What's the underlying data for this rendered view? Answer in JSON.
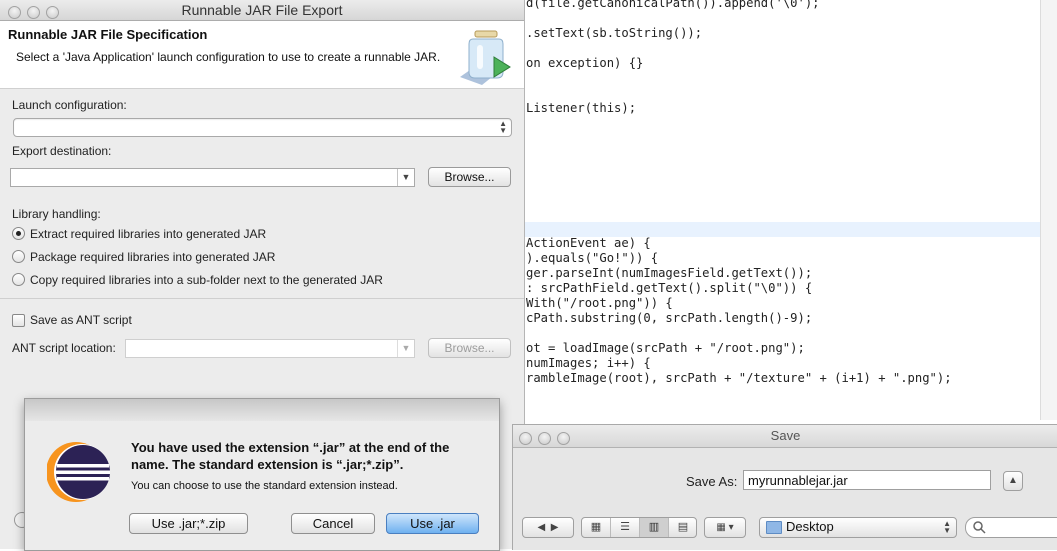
{
  "editor": {
    "lines": [
      "d(file.getCanonicalPath()).append('\\0');",
      ".setText(sb.toString());",
      "on exception) {}",
      "Listener(this);",
      "ActionEvent ae) {",
      ").equals(\"Go!\")) {",
      "ger.parseInt(numImagesField.getText());",
      ": srcPathField.getText().split(\"\\0\")) {",
      "With(\"/root.png\")) {",
      "cPath.substring(0, srcPath.length()-9);",
      "ot = loadImage(srcPath + \"/root.png\");",
      "numImages; i++) {",
      "rambleImage(root), srcPath + \"/texture\" + (i+1) + \".png\");"
    ]
  },
  "export_dialog": {
    "window_title": "Runnable JAR File Export",
    "heading": "Runnable JAR File Specification",
    "description": "Select a 'Java Application' launch configuration to use to create a runnable JAR.",
    "launch_label": "Launch configuration:",
    "launch_value": "",
    "destination_label": "Export destination:",
    "destination_value": "",
    "browse_label": "Browse...",
    "library_label": "Library handling:",
    "library_options": [
      "Extract required libraries into generated JAR",
      "Package required libraries into generated JAR",
      "Copy required libraries into a sub-folder next to the generated JAR"
    ],
    "library_selected_index": 0,
    "save_ant_label": "Save as ANT script",
    "save_ant_checked": false,
    "ant_location_label": "ANT script location:",
    "ant_browse_label": "Browse..."
  },
  "confirm_sheet": {
    "message": "You have used the extension “.jar” at the end of the name. The standard extension is “.jar;*.zip”.",
    "detail": "You can choose to use the standard extension instead.",
    "use_standard_label": "Use .jar;*.zip",
    "cancel_label": "Cancel",
    "use_jar_label": "Use .jar"
  },
  "save_panel": {
    "title": "Save",
    "save_as_label": "Save As:",
    "filename": "myrunnablejar.jar",
    "location": "Desktop"
  },
  "colors": {
    "default_button": "#6fb1f0",
    "string_literal": "#2a00ff",
    "keyword": "#7f0055"
  }
}
